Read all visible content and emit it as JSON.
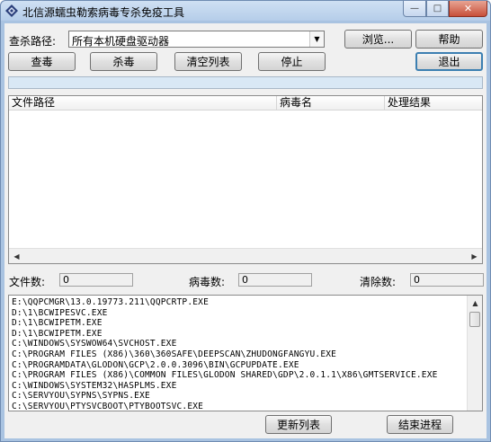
{
  "window": {
    "title": "北信源蠕虫勒索病毒专杀免疫工具",
    "minimize_glyph": "—",
    "maximize_glyph": "□",
    "close_glyph": "✕"
  },
  "scan": {
    "path_label": "查杀路径:",
    "path_value": "所有本机硬盘驱动器",
    "browse_label": "浏览...",
    "help_label": "帮助",
    "scan_label": "查毒",
    "kill_label": "杀毒",
    "clear_label": "清空列表",
    "stop_label": "停止",
    "exit_label": "退出"
  },
  "results": {
    "columns": [
      "文件路径",
      "病毒名",
      "处理结果"
    ]
  },
  "stats": {
    "files_label": "文件数:",
    "files_value": "0",
    "virus_label": "病毒数:",
    "virus_value": "0",
    "cleared_label": "清除数:",
    "cleared_value": "0"
  },
  "process_list": {
    "lines": [
      "E:\\QQPCMGR\\13.0.19773.211\\QQPCRTP.EXE",
      "D:\\1\\BCWIPESVC.EXE",
      "D:\\1\\BCWIPETM.EXE",
      "D:\\1\\BCWIPETM.EXE",
      "C:\\WINDOWS\\SYSWOW64\\SVCHOST.EXE",
      "C:\\PROGRAM FILES (X86)\\360\\360SAFE\\DEEPSCAN\\ZHUDONGFANGYU.EXE",
      "C:\\PROGRAMDATA\\GLODON\\GCP\\2.0.0.3096\\BIN\\GCPUPDATE.EXE",
      "C:\\PROGRAM FILES (X86)\\COMMON FILES\\GLODON SHARED\\GDP\\2.0.1.1\\X86\\GMTSERVICE.EXE",
      "C:\\WINDOWS\\SYSTEM32\\HASPLMS.EXE",
      "C:\\SERVYOU\\SYPNS\\SYPNS.EXE",
      "C:\\SERVYOU\\PTYSVCBOOT\\PTYBOOTSVC.EXE"
    ],
    "refresh_label": "更新列表",
    "end_process_label": "结束进程"
  }
}
